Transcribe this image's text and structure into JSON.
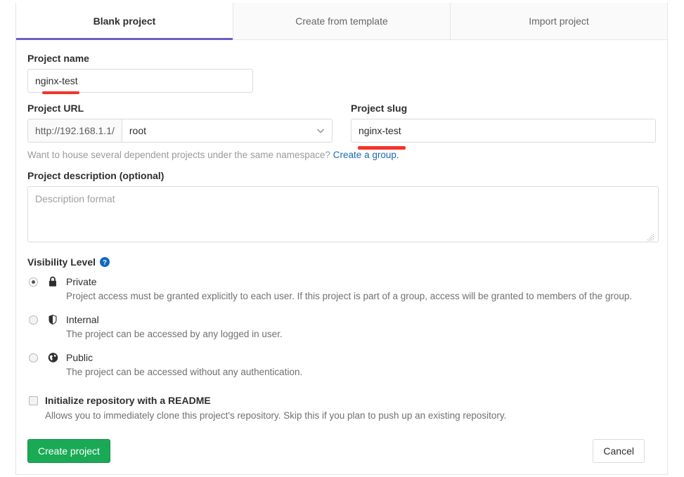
{
  "tabs": [
    {
      "label": "Blank project",
      "active": true
    },
    {
      "label": "Create from template",
      "active": false
    },
    {
      "label": "Import project",
      "active": false
    }
  ],
  "project_name": {
    "label": "Project name",
    "value": "nginx-test",
    "placeholder": ""
  },
  "project_url": {
    "label": "Project URL",
    "prefix": "http://192.168.1.1/",
    "namespace": "root"
  },
  "project_slug": {
    "label": "Project slug",
    "value": "nginx-test",
    "placeholder": ""
  },
  "namespace_hint": {
    "text": "Want to house several dependent projects under the same namespace?",
    "link": "Create a group."
  },
  "description": {
    "label": "Project description (optional)",
    "value": "",
    "placeholder": "Description format"
  },
  "visibility": {
    "heading": "Visibility Level",
    "help_icon": "help-circle-icon",
    "options": [
      {
        "icon": "lock-icon",
        "title": "Private",
        "description": "Project access must be granted explicitly to each user. If this project is part of a group, access will be granted to members of the group.",
        "selected": true
      },
      {
        "icon": "shield-icon",
        "title": "Internal",
        "description": "The project can be accessed by any logged in user.",
        "selected": false
      },
      {
        "icon": "globe-icon",
        "title": "Public",
        "description": "The project can be accessed without any authentication.",
        "selected": false
      }
    ]
  },
  "readme": {
    "title": "Initialize repository with a README",
    "description": "Allows you to immediately clone this project's repository. Skip this if you plan to push up an existing repository.",
    "checked": false
  },
  "actions": {
    "submit_label": "Create project",
    "cancel_label": "Cancel"
  },
  "colors": {
    "accent": "#6b5fc7",
    "primary_button": "#1aaa55",
    "link": "#1b69b6",
    "annotation": "#f5342a"
  }
}
